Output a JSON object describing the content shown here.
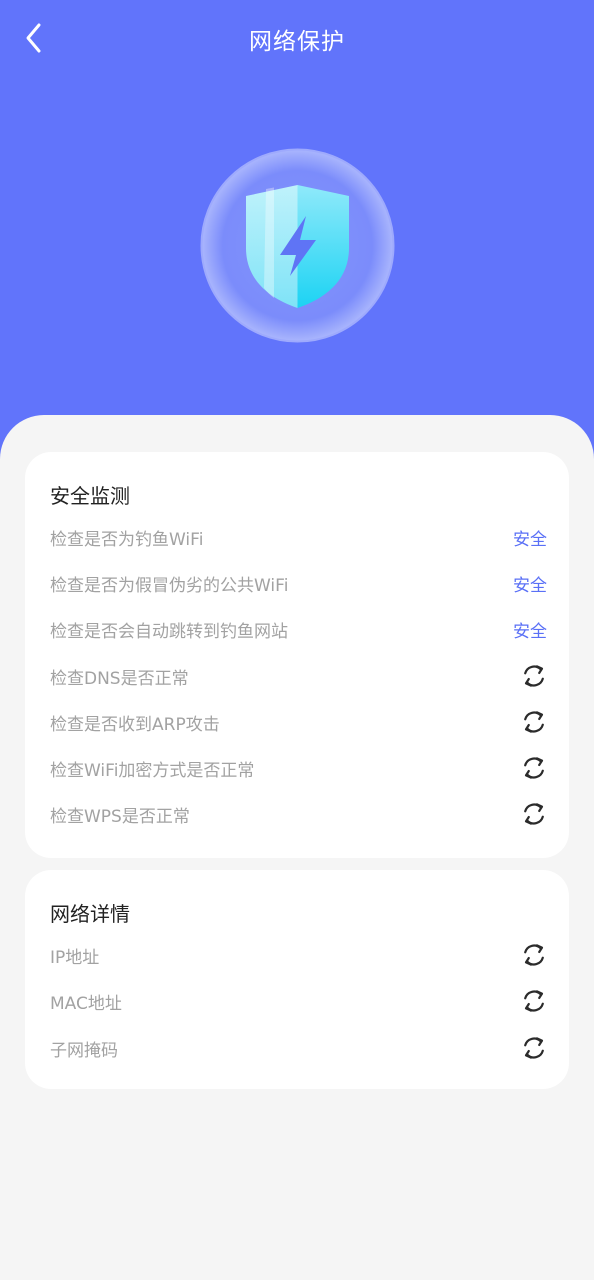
{
  "header": {
    "title": "网络保护",
    "back_icon": "chevron-left-icon"
  },
  "hero": {
    "icon": "shield-lightning-icon",
    "background_color": "#6174fb"
  },
  "security_card": {
    "title": "安全监测",
    "items": [
      {
        "label": "检查是否为钓鱼WiFi",
        "status": "安全"
      },
      {
        "label": "检查是否为假冒伪劣的公共WiFi",
        "status": "安全"
      },
      {
        "label": "检查是否会自动跳转到钓鱼网站",
        "status": "安全"
      },
      {
        "label": "检查DNS是否正常",
        "icon": "refresh-icon"
      },
      {
        "label": "检查是否收到ARP攻击",
        "icon": "refresh-icon"
      },
      {
        "label": "检查WiFi加密方式是否正常",
        "icon": "refresh-icon"
      },
      {
        "label": "检查WPS是否正常",
        "icon": "refresh-icon"
      }
    ]
  },
  "network_card": {
    "title": "网络详情",
    "items": [
      {
        "label": "IP地址",
        "icon": "refresh-icon"
      },
      {
        "label": "MAC地址",
        "icon": "refresh-icon"
      },
      {
        "label": "子网掩码",
        "icon": "refresh-icon"
      }
    ]
  },
  "colors": {
    "accent": "#5a70f6",
    "muted_text": "#a2a2a2",
    "page_bg": "#f5f5f5"
  }
}
